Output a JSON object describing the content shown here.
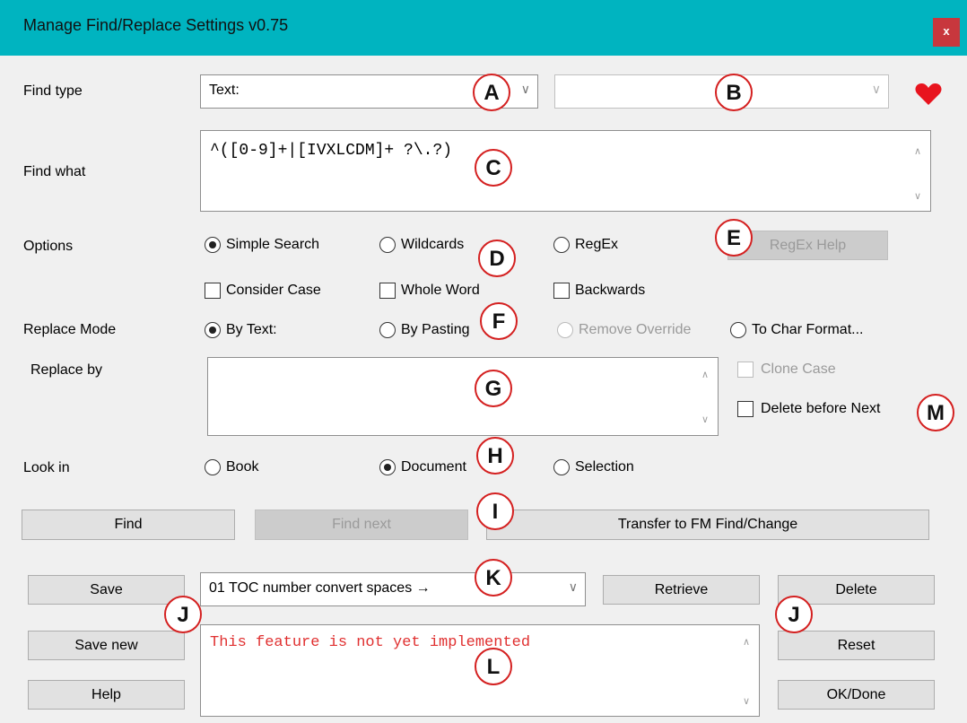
{
  "window": {
    "title": "Manage Find/Replace Settings v0.75",
    "close_label": "x"
  },
  "labels": {
    "find_type": "Find type",
    "find_what": "Find what",
    "options": "Options",
    "replace_mode": "Replace Mode",
    "replace_by": "Replace by",
    "look_in": "Look in"
  },
  "find_type": {
    "value": "Text:",
    "second_value": ""
  },
  "find_what": {
    "value": "^([0-9]+|[IVXLCDM]+ ?\\.?)"
  },
  "options": {
    "simple_search": "Simple Search",
    "wildcards": "Wildcards",
    "regex": "RegEx",
    "regex_help": "RegEx Help",
    "consider_case": "Consider Case",
    "whole_word": "Whole Word",
    "backwards": "Backwards"
  },
  "replace_mode": {
    "by_text": "By Text:",
    "by_pasting": "By Pasting",
    "remove_override": "Remove Override",
    "to_char_format": "To Char Format..."
  },
  "replace_by": {
    "value": "",
    "clone_case": "Clone Case",
    "delete_before_next": "Delete before Next"
  },
  "look_in": {
    "book": "Book",
    "document": "Document",
    "selection": "Selection"
  },
  "actions": {
    "find": "Find",
    "find_next": "Find next",
    "transfer": "Transfer to FM Find/Change"
  },
  "settings": {
    "save": "Save",
    "save_new": "Save new",
    "help": "Help",
    "selected": "01 TOC number convert spaces →",
    "retrieve": "Retrieve",
    "delete": "Delete",
    "reset": "Reset",
    "ok_done": "OK/Done",
    "message": "This feature is not yet implemented"
  },
  "callouts": [
    "A",
    "B",
    "C",
    "D",
    "E",
    "F",
    "G",
    "H",
    "I",
    "J",
    "K",
    "L",
    "J",
    "M"
  ],
  "icons": {
    "favorite": "heart-icon"
  },
  "colors": {
    "titlebar": "#00b4c0",
    "close": "#c8373d",
    "callout_ring": "#d42020",
    "message": "#e03030"
  }
}
